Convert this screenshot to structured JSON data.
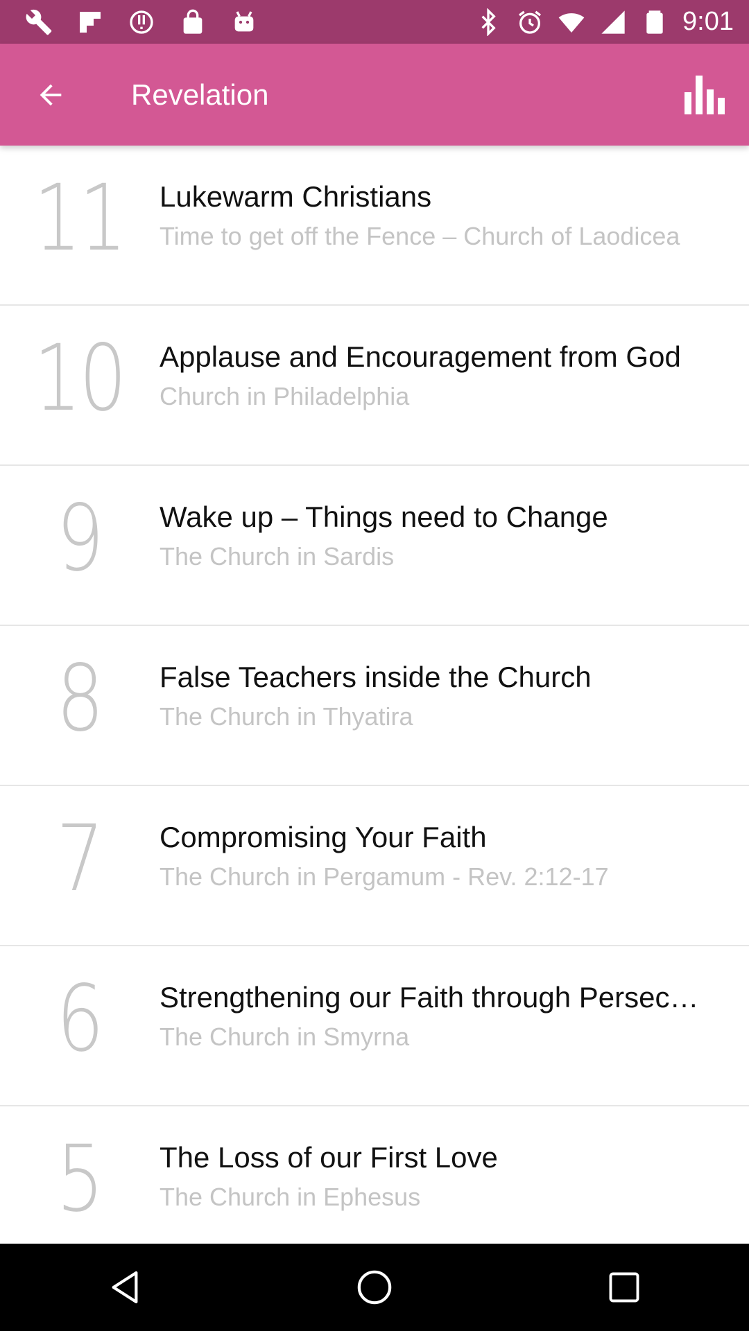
{
  "status_bar": {
    "time": "9:01",
    "left_icons": [
      "wrench-icon",
      "flipboard-icon",
      "alert-icon",
      "lock-icon",
      "android-icon"
    ],
    "right_icons": [
      "bluetooth-icon",
      "alarm-icon",
      "wifi-icon",
      "signal-icon",
      "battery-icon"
    ]
  },
  "app_bar": {
    "title": "Revelation",
    "back_icon": "arrow-back-icon",
    "action_icon": "bar-chart-icon",
    "color": "#d35894"
  },
  "items": [
    {
      "number": "11",
      "title": "Lukewarm Christians",
      "subtitle": "Time to get off the Fence – Church of Laodicea"
    },
    {
      "number": "10",
      "title": "Applause and Encouragement from God",
      "subtitle": "Church in Philadelphia"
    },
    {
      "number": "9",
      "title": "Wake up – Things need to Change",
      "subtitle": "The Church in Sardis"
    },
    {
      "number": "8",
      "title": "False Teachers inside the Church",
      "subtitle": "The Church in Thyatira"
    },
    {
      "number": "7",
      "title": "Compromising Your Faith",
      "subtitle": "The Church in Pergamum - Rev. 2:12-17"
    },
    {
      "number": "6",
      "title": "Strengthening our Faith through Persecution",
      "subtitle": "The Church in Smyrna"
    },
    {
      "number": "5",
      "title": "The Loss of our First Love",
      "subtitle": "The Church in Ephesus"
    }
  ],
  "nav_bar": {
    "buttons": [
      "back-triangle-icon",
      "home-circle-icon",
      "recents-square-icon"
    ]
  }
}
